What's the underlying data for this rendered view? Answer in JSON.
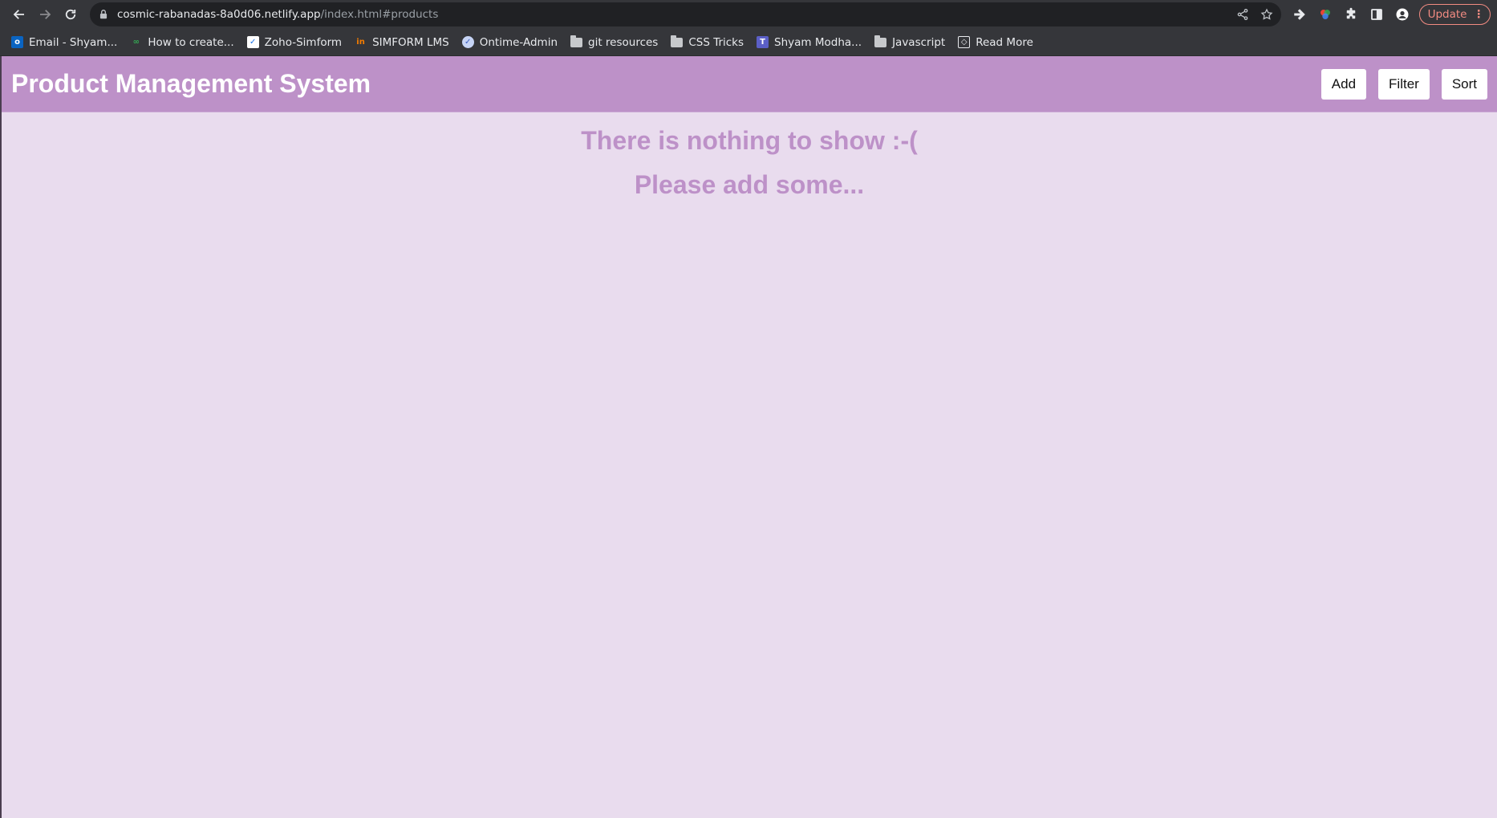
{
  "browser": {
    "url_host": "cosmic-rabanadas-8a0d06.netlify.app",
    "url_path": "/index.html#products",
    "update_label": "Update",
    "bookmarks": [
      {
        "label": "Email - Shyam...",
        "icon": "outlook-icon"
      },
      {
        "label": "How to create...",
        "icon": "link-icon"
      },
      {
        "label": "Zoho-Simform",
        "icon": "zoho-icon"
      },
      {
        "label": "SIMFORM LMS",
        "icon": "lms-icon"
      },
      {
        "label": "Ontime-Admin",
        "icon": "ontime-icon"
      },
      {
        "label": "git resources",
        "icon": "folder-icon"
      },
      {
        "label": "CSS Tricks",
        "icon": "folder-icon"
      },
      {
        "label": "Shyam Modha...",
        "icon": "teams-icon"
      },
      {
        "label": "Javascript",
        "icon": "folder-icon"
      },
      {
        "label": "Read More",
        "icon": "codepen-icon"
      }
    ]
  },
  "header": {
    "title": "Product Management System",
    "add_label": "Add",
    "filter_label": "Filter",
    "sort_label": "Sort"
  },
  "empty_state": {
    "line1": "There is nothing to show :-(",
    "line2": "Please add some..."
  },
  "colors": {
    "accent": "#bd91c8",
    "page_bg": "#e9dcee"
  }
}
